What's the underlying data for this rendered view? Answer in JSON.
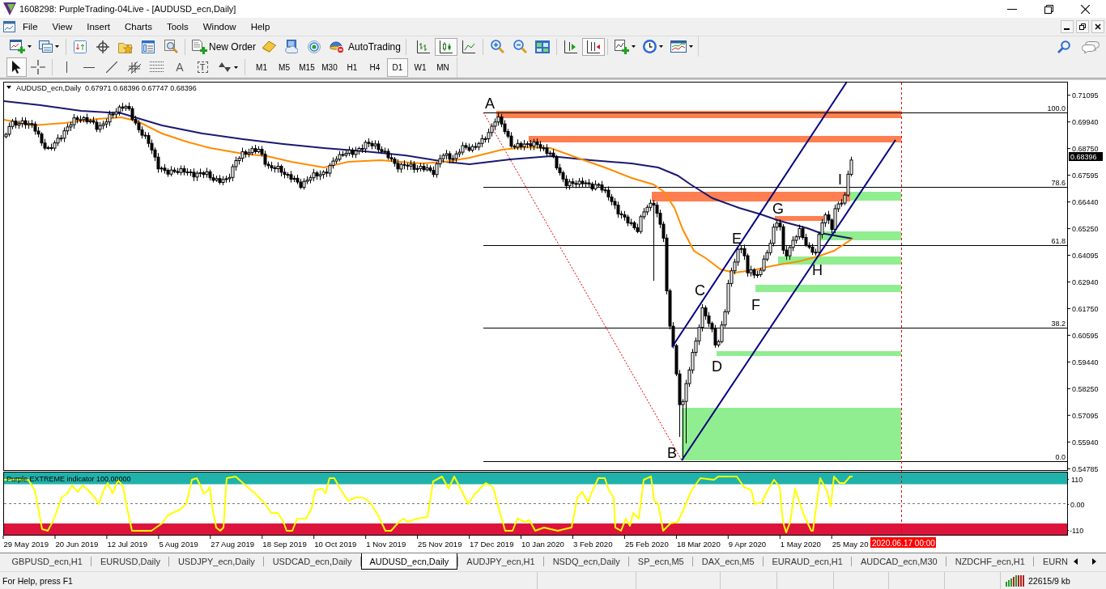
{
  "window": {
    "title": "1608298: PurpleTrading-04Live - [AUDUSD_ecn,Daily]"
  },
  "menu": [
    "File",
    "View",
    "Insert",
    "Charts",
    "Tools",
    "Window",
    "Help"
  ],
  "toolbar": {
    "new_order": "New Order",
    "auto_trading": "AutoTrading",
    "chart_types": [
      {
        "kind": "bars",
        "selected": false
      },
      {
        "kind": "candles",
        "selected": true
      },
      {
        "kind": "line",
        "selected": false
      }
    ],
    "view_toggles": [
      {
        "kind": "auto_scroll",
        "selected": false
      },
      {
        "kind": "chart_shift",
        "selected": true
      }
    ]
  },
  "drawing_tools": [
    {
      "kind": "cursor",
      "selected": true
    },
    {
      "kind": "crosshair",
      "selected": false
    },
    {
      "kind": "vertical_line",
      "selected": false
    },
    {
      "kind": "horizontal_line",
      "selected": false
    },
    {
      "kind": "trend_line",
      "selected": false
    },
    {
      "kind": "channel",
      "selected": false
    },
    {
      "kind": "fibonacci",
      "selected": false
    },
    {
      "kind": "text",
      "label": "A",
      "selected": false
    },
    {
      "kind": "text_label",
      "label": "T",
      "selected": false
    },
    {
      "kind": "arrows",
      "selected": false
    }
  ],
  "timeframes": [
    {
      "label": "M1",
      "selected": false
    },
    {
      "label": "M5",
      "selected": false
    },
    {
      "label": "M15",
      "selected": false
    },
    {
      "label": "M30",
      "selected": false
    },
    {
      "label": "H1",
      "selected": false
    },
    {
      "label": "H4",
      "selected": false
    },
    {
      "label": "D1",
      "selected": true
    },
    {
      "label": "W1",
      "selected": false
    },
    {
      "label": "MN",
      "selected": false
    }
  ],
  "chart": {
    "header": {
      "symbol": "AUDUSD_ecn,Daily",
      "open": "0.67971",
      "high": "0.68396",
      "low": "0.67747",
      "close": "0.68396"
    },
    "price_axis": [
      "0.71095",
      "0.69940",
      "0.68750",
      "0.67595",
      "0.66440",
      "0.65250",
      "0.64095",
      "0.62940",
      "0.61750",
      "0.60595",
      "0.59440",
      "0.58250",
      "0.57095",
      "0.55940",
      "0.54785"
    ],
    "current_price": "0.68396",
    "fib_levels": [
      "100.0",
      "78.6",
      "61.8",
      "38.2",
      "0.0"
    ],
    "wave_labels": [
      "A",
      "B",
      "C",
      "D",
      "E",
      "F",
      "G",
      "H",
      "I"
    ],
    "date_axis": [
      "29 May 2019",
      "20 Jun 2019",
      "12 Jul 2019",
      "5 Aug 2019",
      "27 Aug 2019",
      "18 Sep 2019",
      "10 Oct 2019",
      "1 Nov 2019",
      "25 Nov 2019",
      "17 Dec 2019",
      "10 Jan 2020",
      "3 Feb 2020",
      "25 Feb 2020",
      "18 Mar 2020",
      "9 Apr 2020",
      "1 May 2020",
      "25 May 20"
    ],
    "cursor_time": "2020.06.17 00:00"
  },
  "indicator": {
    "title": "Purple EXTREME indicator 100.00000",
    "axis": [
      "110",
      "0.00",
      "-110"
    ]
  },
  "tabs": [
    {
      "label": "GBPUSD_ecn,H1",
      "selected": false
    },
    {
      "label": "EURUSD,Daily",
      "selected": false
    },
    {
      "label": "USDJPY_ecn,Daily",
      "selected": false
    },
    {
      "label": "USDCAD_ecn,Daily",
      "selected": false
    },
    {
      "label": "AUDUSD_ecn,Daily",
      "selected": true
    },
    {
      "label": "AUDJPY_ecn,H1",
      "selected": false
    },
    {
      "label": "NSDQ_ecn,Daily",
      "selected": false
    },
    {
      "label": "SP_ecn,M5",
      "selected": false
    },
    {
      "label": "DAX_ecn,M5",
      "selected": false
    },
    {
      "label": "EURAUD_ecn,H1",
      "selected": false
    },
    {
      "label": "AUDCAD_ecn,M30",
      "selected": false
    },
    {
      "label": "NZDCHF_ecn,H1",
      "selected": false
    },
    {
      "label": "EURN",
      "selected": false
    }
  ],
  "status_bar": {
    "help": "For Help, press F1",
    "traffic": "22615/9 kb"
  }
}
